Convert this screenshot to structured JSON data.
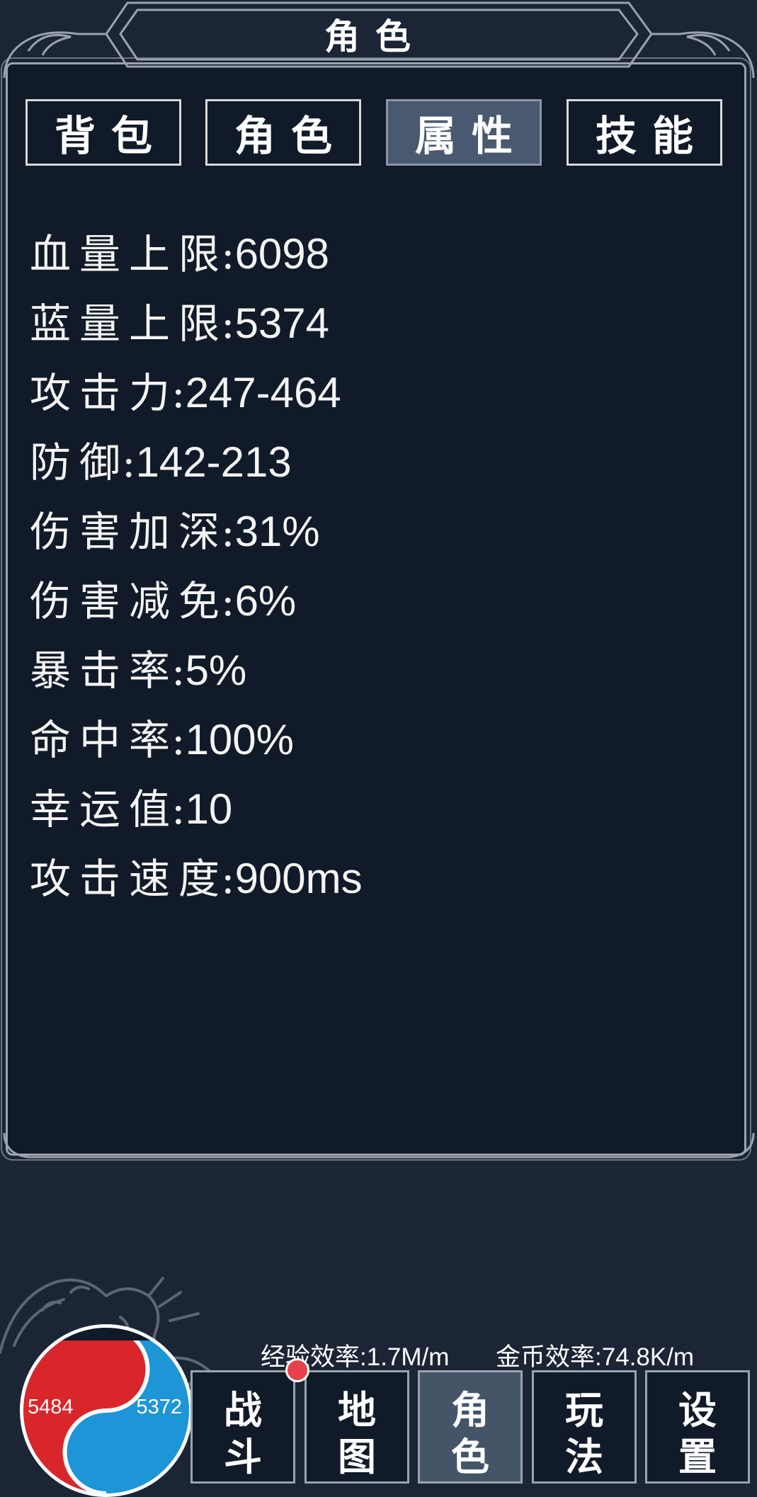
{
  "header": {
    "title": "角色"
  },
  "tabs": [
    {
      "label": "背包",
      "active": false
    },
    {
      "label": "角色",
      "active": false
    },
    {
      "label": "属性",
      "active": true
    },
    {
      "label": "技能",
      "active": false
    }
  ],
  "stats": [
    {
      "label": "血量上限",
      "value": "6098"
    },
    {
      "label": "蓝量上限",
      "value": "5374"
    },
    {
      "label": "攻击力",
      "value": "247-464"
    },
    {
      "label": "防御",
      "value": "142-213"
    },
    {
      "label": "伤害加深",
      "value": "31%"
    },
    {
      "label": "伤害减免",
      "value": "6%"
    },
    {
      "label": "暴击率",
      "value": "5%"
    },
    {
      "label": "命中率",
      "value": "100%"
    },
    {
      "label": "幸运值",
      "value": "10"
    },
    {
      "label": "攻击速度",
      "value": "900ms"
    }
  ],
  "orb": {
    "hp": "5484",
    "mp": "5372",
    "hp_color": "#d9262b",
    "mp_color": "#1e95d6"
  },
  "efficiency": {
    "exp": "经验效率:1.7M/m",
    "gold": "金币效率:74.8K/m"
  },
  "nav": [
    {
      "line1": "战",
      "line2": "斗",
      "active": false,
      "badge": true
    },
    {
      "line1": "地",
      "line2": "图",
      "active": false
    },
    {
      "line1": "角",
      "line2": "色",
      "active": true
    },
    {
      "line1": "玩",
      "line2": "法",
      "active": false
    },
    {
      "line1": "设",
      "line2": "置",
      "active": false
    }
  ],
  "colors": {
    "background": "#1b2535",
    "panel": "#111a28",
    "active_tab": "#495a70",
    "border": "#9aa3ad"
  }
}
